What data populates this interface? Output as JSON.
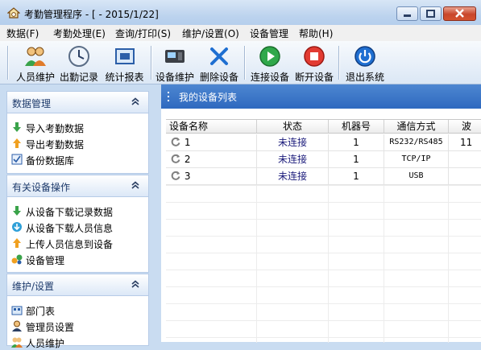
{
  "window": {
    "title": "考勤管理程序 - [ - 2015/1/22]"
  },
  "menu": [
    {
      "label": "数据(F)"
    },
    {
      "label": "考勤处理(E)"
    },
    {
      "label": "查询/打印(S)"
    },
    {
      "label": "维护/设置(O)"
    },
    {
      "label": "设备管理"
    },
    {
      "label": "帮助(H)"
    }
  ],
  "toolbar": [
    {
      "label": "人员维护",
      "icon": "users-icon"
    },
    {
      "label": "出勤记录",
      "icon": "clock-icon"
    },
    {
      "label": "统计报表",
      "icon": "report-icon"
    },
    {
      "label": "设备维护",
      "icon": "device-icon"
    },
    {
      "label": "删除设备",
      "icon": "delete-icon"
    },
    {
      "label": "连接设备",
      "icon": "connect-icon"
    },
    {
      "label": "断开设备",
      "icon": "disconnect-icon"
    },
    {
      "label": "退出系统",
      "icon": "power-icon"
    }
  ],
  "sidebar": {
    "groups": [
      {
        "title": "数据管理",
        "items": [
          {
            "label": "导入考勤数据",
            "icon": "arrow-down-green-icon"
          },
          {
            "label": "导出考勤数据",
            "icon": "arrow-up-orange-icon"
          },
          {
            "label": "备份数据库",
            "icon": "backup-icon"
          }
        ]
      },
      {
        "title": "有关设备操作",
        "items": [
          {
            "label": "从设备下载记录数据",
            "icon": "arrow-down-green-icon"
          },
          {
            "label": "从设备下载人员信息",
            "icon": "download-circle-icon"
          },
          {
            "label": "上传人员信息到设备",
            "icon": "arrow-up-orange-icon"
          },
          {
            "label": "设备管理",
            "icon": "devices-icon"
          }
        ]
      },
      {
        "title": "维护/设置",
        "items": [
          {
            "label": "部门表",
            "icon": "department-icon"
          },
          {
            "label": "管理员设置",
            "icon": "admin-icon"
          },
          {
            "label": "人员维护",
            "icon": "users-icon"
          }
        ]
      }
    ]
  },
  "device_panel": {
    "title": "我的设备列表",
    "columns": [
      "设备名称",
      "状态",
      "机器号",
      "通信方式",
      "波"
    ],
    "rows": [
      {
        "name": "1",
        "status": "未连接",
        "machine": "1",
        "comm": "RS232/RS485",
        "baud": "11"
      },
      {
        "name": "2",
        "status": "未连接",
        "machine": "1",
        "comm": "TCP/IP",
        "baud": ""
      },
      {
        "name": "3",
        "status": "未连接",
        "machine": "1",
        "comm": "USB",
        "baud": ""
      }
    ]
  },
  "colors": {
    "panel_header": "#2e69bf",
    "status_text": "#1a1a7a",
    "group_title": "#1d3a6b"
  }
}
